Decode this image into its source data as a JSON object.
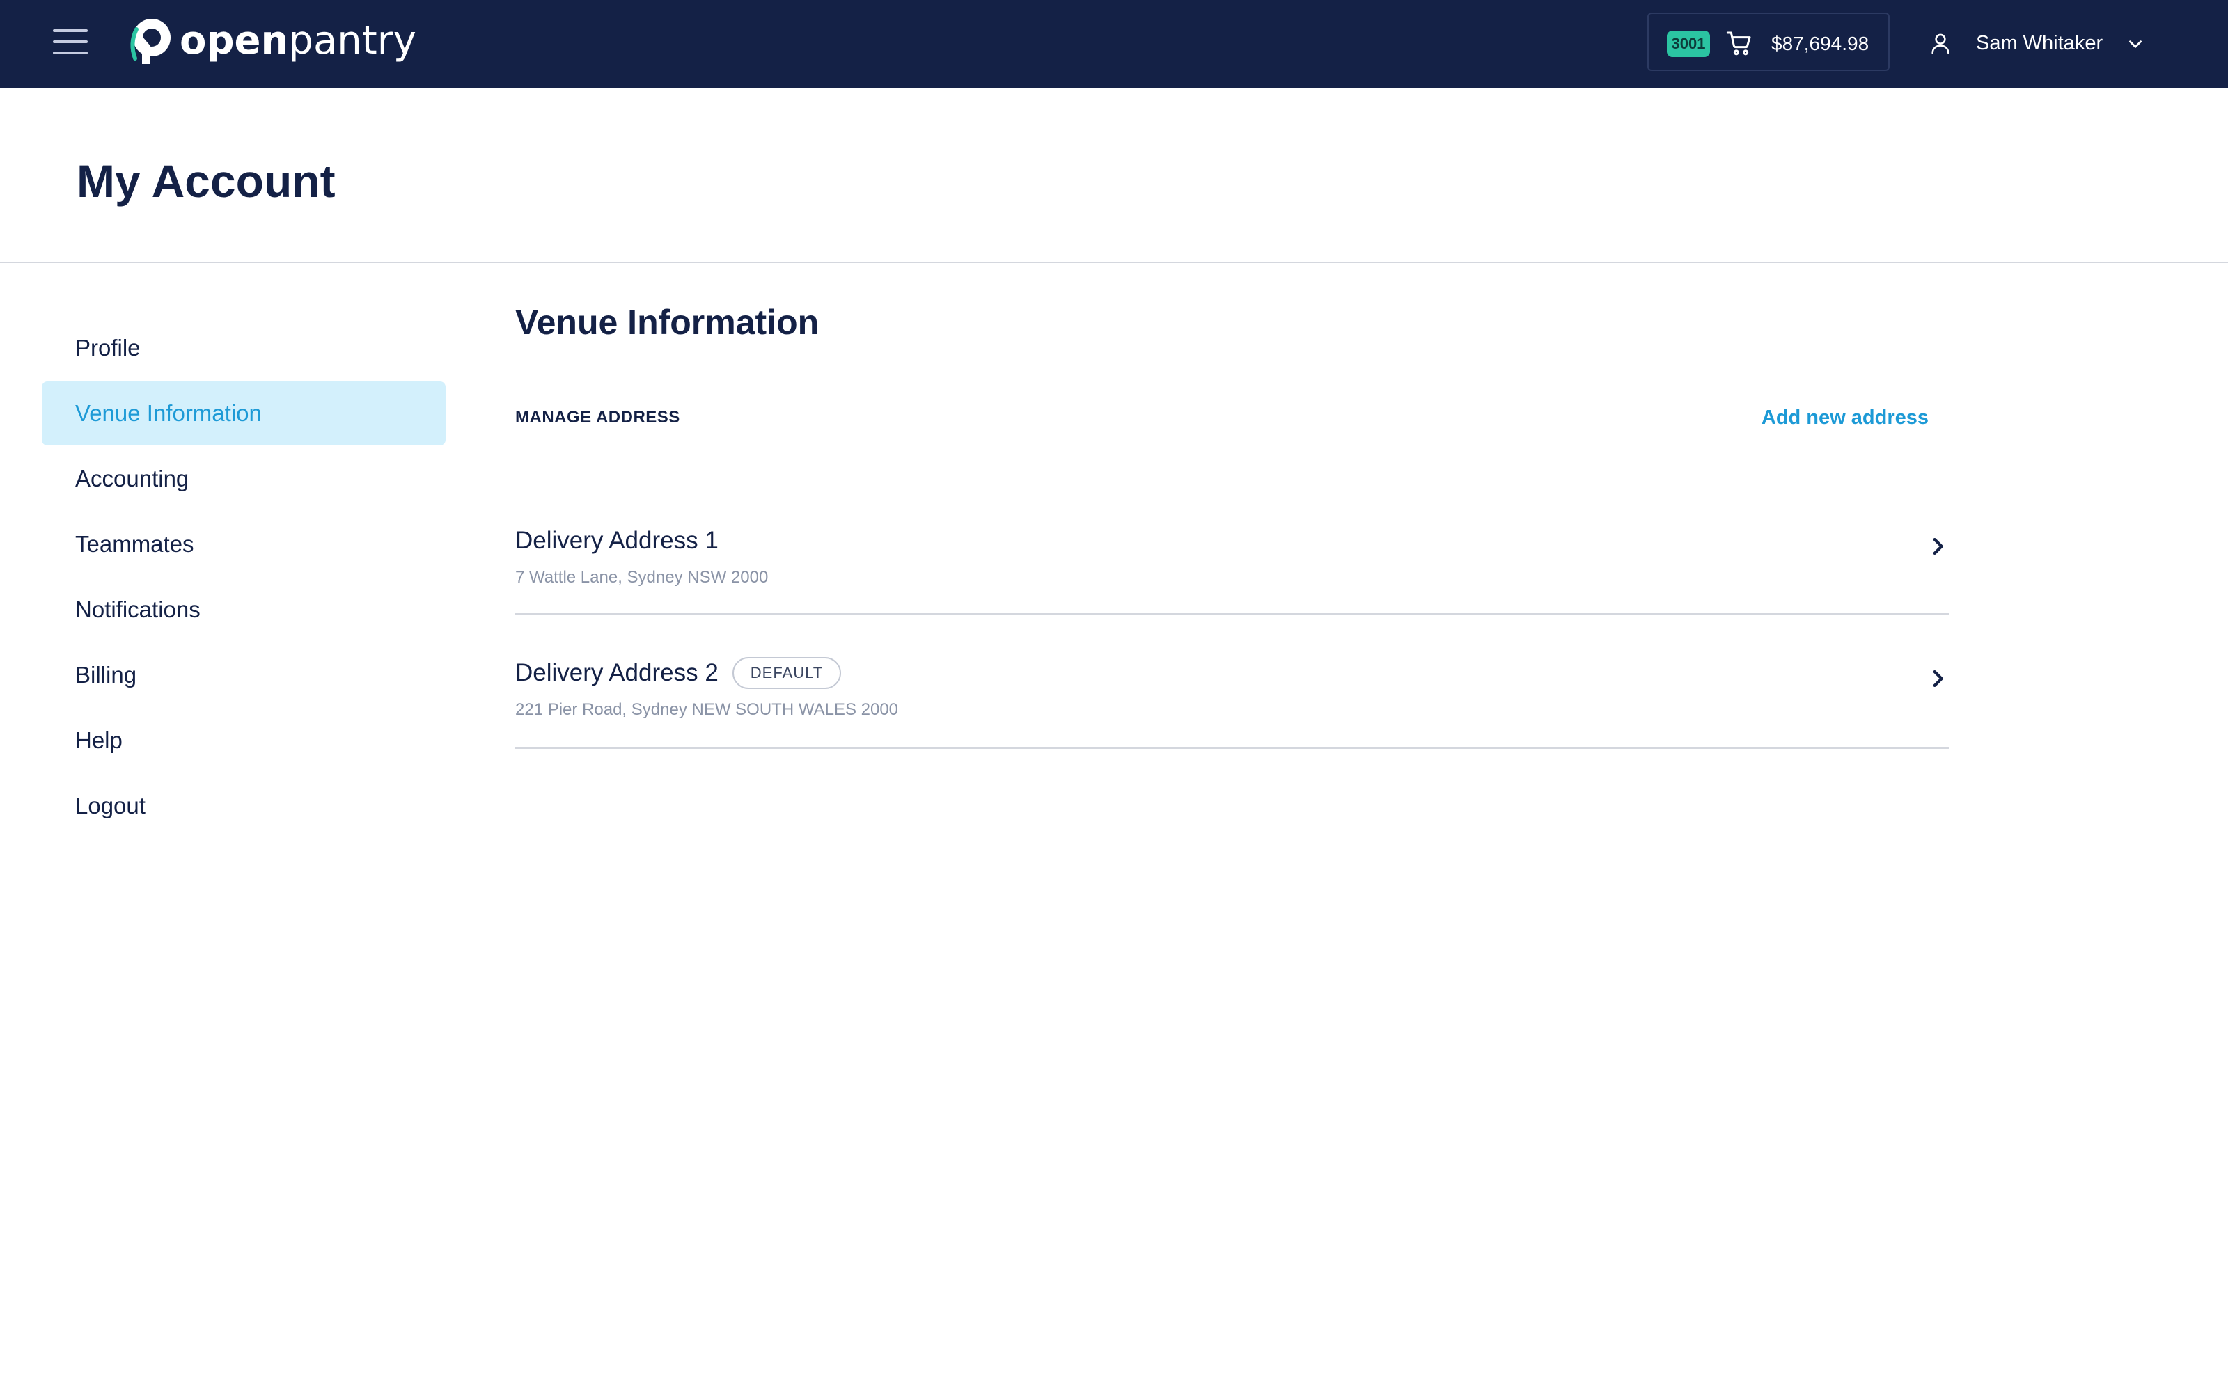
{
  "app": {
    "brand_bold": "open",
    "brand_light": "pantry"
  },
  "cart": {
    "badge": "3001",
    "total": "$87,694.98"
  },
  "user": {
    "name": "Sam Whitaker"
  },
  "page": {
    "title": "My Account"
  },
  "sidebar": {
    "items": [
      {
        "label": "Profile",
        "active": false
      },
      {
        "label": "Venue Information",
        "active": true
      },
      {
        "label": "Accounting",
        "active": false
      },
      {
        "label": "Teammates",
        "active": false
      },
      {
        "label": "Notifications",
        "active": false
      },
      {
        "label": "Billing",
        "active": false
      },
      {
        "label": "Help",
        "active": false
      },
      {
        "label": "Logout",
        "active": false
      }
    ]
  },
  "main": {
    "section_title": "Venue Information",
    "manage_label": "MANAGE ADDRESS",
    "add_link": "Add new address",
    "addresses": [
      {
        "title": "Delivery Address 1",
        "address": "7 Wattle Lane, Sydney NSW 2000",
        "default": false
      },
      {
        "title": "Delivery Address 2",
        "address": "221 Pier Road, Sydney NEW SOUTH WALES 2000",
        "default": true,
        "default_label": "DEFAULT"
      }
    ]
  },
  "colors": {
    "navbar": "#142146",
    "accent": "#1d9ad6",
    "active_bg": "#d3f0fc",
    "badge": "#2bc4a2"
  },
  "icons": [
    "menu-icon",
    "logo-mark-icon",
    "cart-icon",
    "user-icon",
    "chevron-down-icon",
    "chevron-right-icon"
  ]
}
